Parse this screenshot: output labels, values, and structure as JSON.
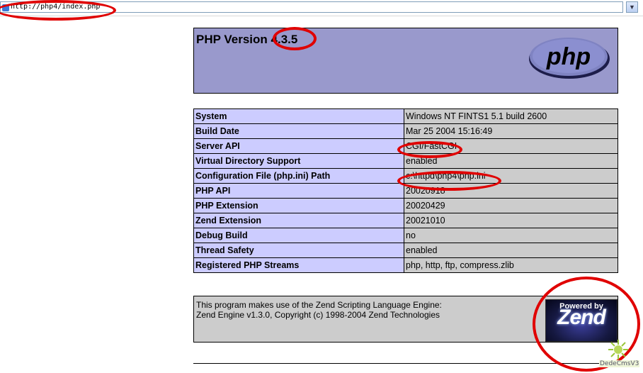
{
  "address_bar": {
    "url": "http://php4/index.php",
    "dropdown_glyph": "▼",
    "page_icon": "ie-page-icon"
  },
  "header": {
    "title_prefix": "PHP Version ",
    "version": "4.3.5",
    "logo_text": "php"
  },
  "info_table": [
    {
      "label": "System",
      "value": "Windows NT FINTS1 5.1 build 2600"
    },
    {
      "label": "Build Date",
      "value": "Mar 25 2004 15:16:49"
    },
    {
      "label": "Server API",
      "value": "CGI/FastCGI"
    },
    {
      "label": "Virtual Directory Support",
      "value": "enabled"
    },
    {
      "label": "Configuration File (php.ini) Path",
      "value": "c:\\httpd\\php4\\php.ini"
    },
    {
      "label": "PHP API",
      "value": "20020918"
    },
    {
      "label": "PHP Extension",
      "value": "20020429"
    },
    {
      "label": "Zend Extension",
      "value": "20021010"
    },
    {
      "label": "Debug Build",
      "value": "no"
    },
    {
      "label": "Thread Safety",
      "value": "enabled"
    },
    {
      "label": "Registered PHP Streams",
      "value": "php, http, ftp, compress.zlib"
    }
  ],
  "zend": {
    "line1": "This program makes use of the Zend Scripting Language Engine:",
    "line2": "Zend Engine v1.3.0, Copyright (c) 1998-2004 Zend Technologies",
    "logo_powered": "Powered by",
    "logo_word": "Zend"
  },
  "watermark": {
    "text": "DedeCmsV3"
  },
  "colors": {
    "header_bg": "#9999cc",
    "label_bg": "#ccccff",
    "value_bg": "#cccccc",
    "annotation": "#e00000"
  }
}
